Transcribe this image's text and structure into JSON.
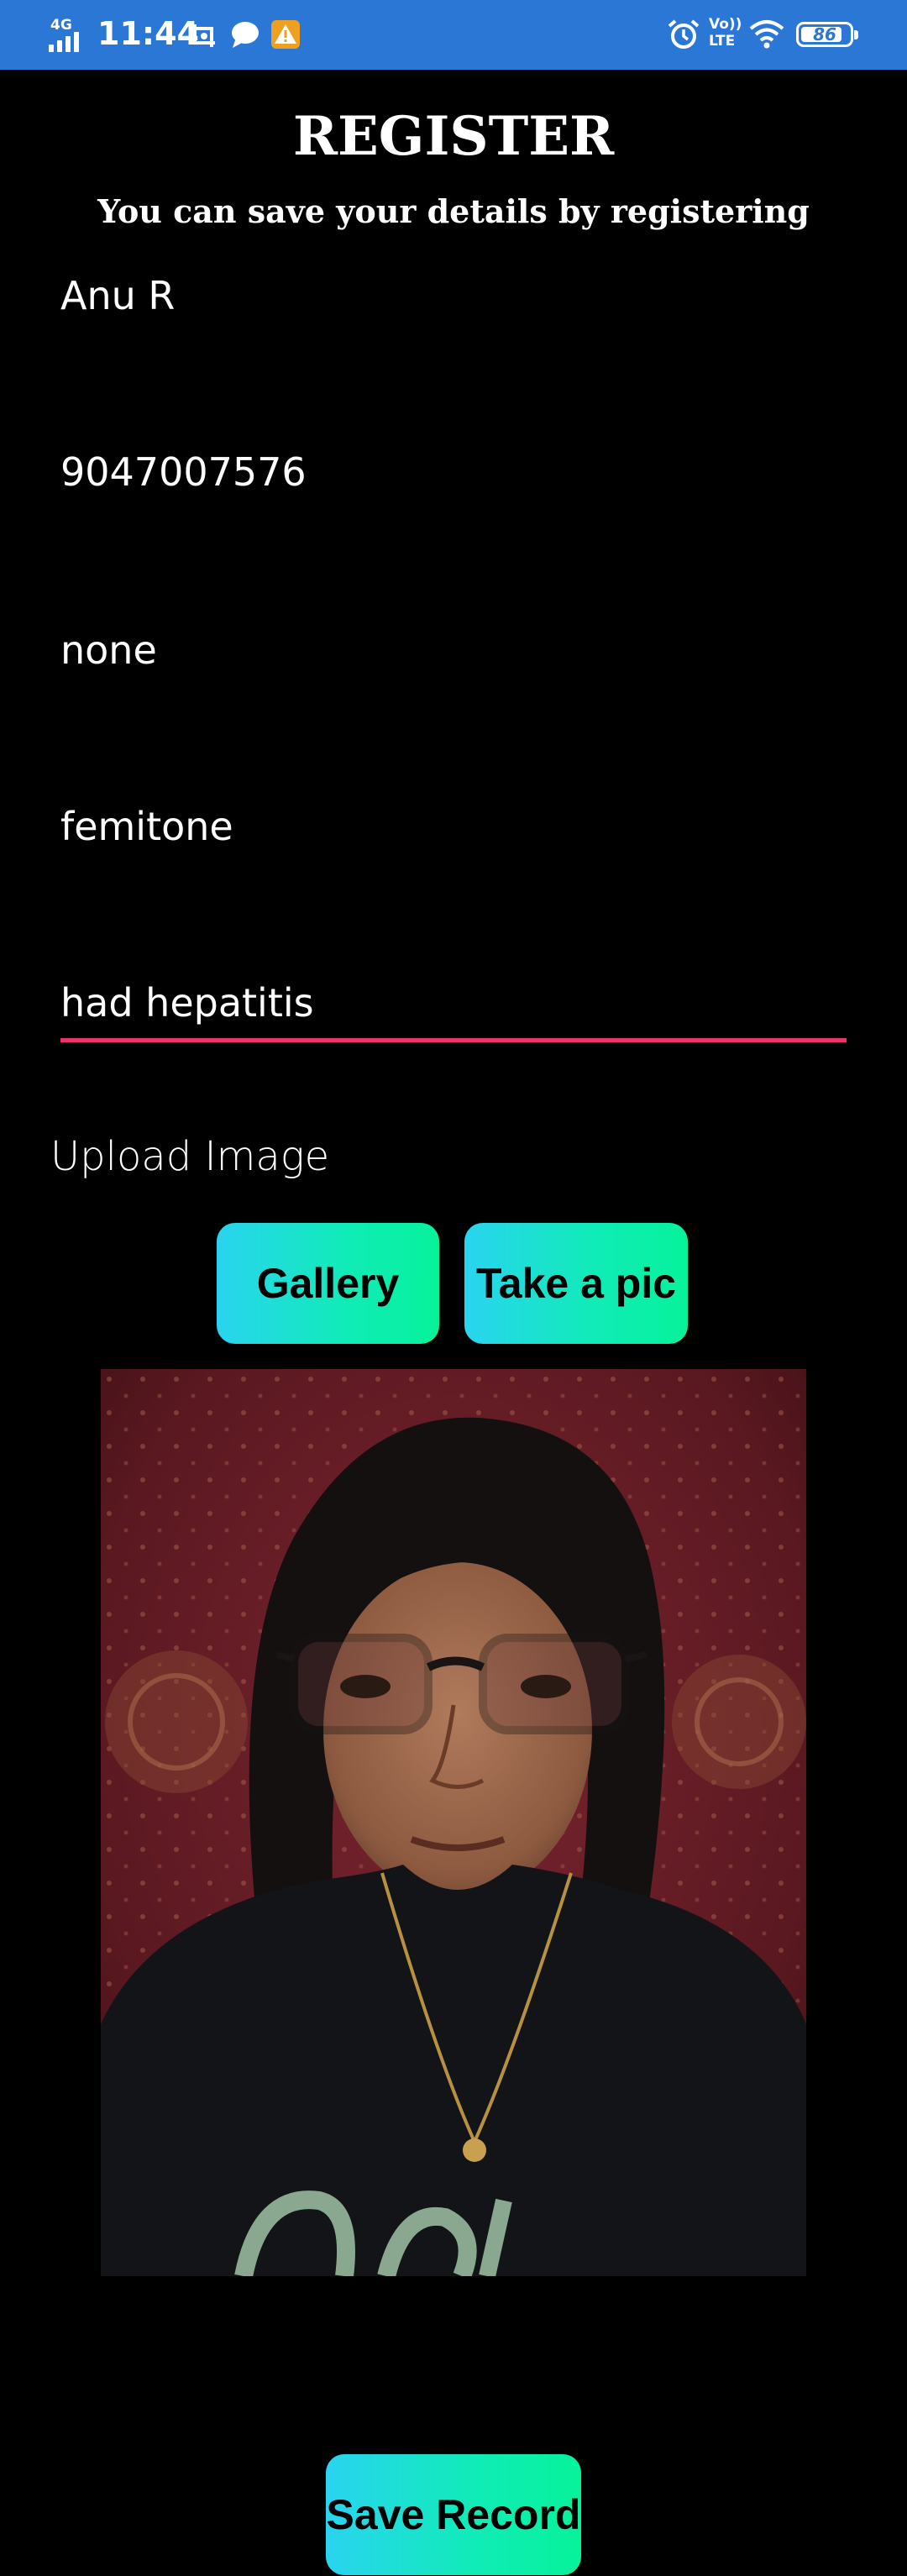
{
  "status_bar": {
    "network_type": "4G",
    "time": "11:44",
    "volte_label": "Vo)) LTE",
    "battery_level": "86",
    "battery_fraction": 0.86,
    "icons": [
      "signal-bars-icon",
      "screenshot-icon",
      "message-bubble-icon",
      "warning-icon",
      "alarm-icon",
      "wifi-icon",
      "battery-icon"
    ],
    "colors": {
      "background": "#2a77d6",
      "warning": "#f0a020"
    }
  },
  "header": {
    "title": "REGISTER",
    "subtitle": "You can save your details by registering"
  },
  "form": {
    "fields": [
      {
        "value": "Anu R"
      },
      {
        "value": "9047007576"
      },
      {
        "value": "none"
      },
      {
        "value": "femitone"
      },
      {
        "value": "had hepatitis",
        "focused": true
      }
    ],
    "focus_color": "#e8336b"
  },
  "upload": {
    "label": "Upload Image",
    "gallery_label": "Gallery",
    "take_pic_label": "Take a pic",
    "button_gradient": [
      "#2ad4f0",
      "#06f29a"
    ]
  },
  "photo": {
    "alt": "uploaded photo"
  },
  "save": {
    "label": "Save Record"
  }
}
